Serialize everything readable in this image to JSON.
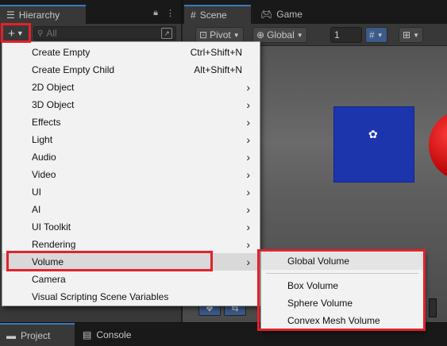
{
  "hierarchy": {
    "tab_label": "Hierarchy",
    "search_placeholder": "All"
  },
  "scene": {
    "tab_label": "Scene",
    "game_tab_label": "Game",
    "pivot_label": "Pivot",
    "global_label": "Global",
    "grid_value": "1"
  },
  "menu": {
    "items": [
      {
        "label": "Create Empty",
        "shortcut": "Ctrl+Shift+N"
      },
      {
        "label": "Create Empty Child",
        "shortcut": "Alt+Shift+N"
      },
      {
        "label": "2D Object"
      },
      {
        "label": "3D Object"
      },
      {
        "label": "Effects"
      },
      {
        "label": "Light"
      },
      {
        "label": "Audio"
      },
      {
        "label": "Video"
      },
      {
        "label": "UI"
      },
      {
        "label": "AI"
      },
      {
        "label": "UI Toolkit"
      },
      {
        "label": "Rendering"
      },
      {
        "label": "Volume"
      },
      {
        "label": "Camera"
      },
      {
        "label": "Visual Scripting Scene Variables"
      }
    ],
    "submenu_arrow": "›"
  },
  "volume_submenu": {
    "items": [
      {
        "label": "Global Volume"
      },
      {
        "label": "Box Volume"
      },
      {
        "label": "Sphere Volume"
      },
      {
        "label": "Convex Mesh Volume"
      }
    ]
  },
  "bottom": {
    "project_label": "Project",
    "console_label": "Console"
  },
  "colors": {
    "highlight_annotation": "#e3212b",
    "cube": "#1c35ad",
    "sphere": "#d11a1a",
    "tab_accent": "#3a79bb"
  }
}
